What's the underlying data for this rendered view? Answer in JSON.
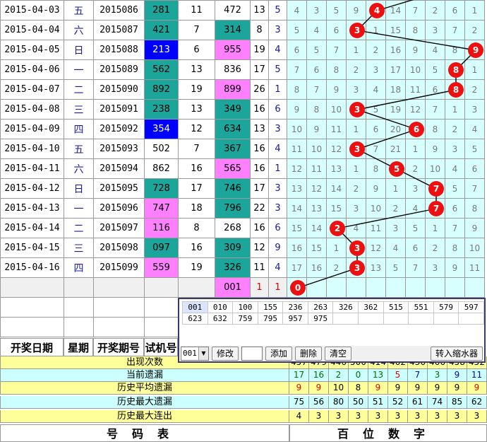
{
  "rows": [
    {
      "date": "2015-04-03",
      "week": "五",
      "issue": "2015086",
      "t": "281",
      "t_hl": "teal",
      "s": "11",
      "n": "472",
      "n_hl": "",
      "a": "13",
      "b": "5",
      "cells": [
        "4",
        "3",
        "5",
        "9",
        "",
        "14",
        "7",
        "2",
        "6",
        "1"
      ],
      "ball": "4",
      "ball_col": 4
    },
    {
      "date": "2015-04-04",
      "week": "六",
      "issue": "2015087",
      "t": "421",
      "t_hl": "teal",
      "s": "7",
      "n": "314",
      "n_hl": "teal",
      "a": "8",
      "b": "3",
      "cells": [
        "5",
        "4",
        "6",
        "",
        "1",
        "15",
        "8",
        "3",
        "7",
        "2"
      ],
      "ball": "3",
      "ball_col": 3
    },
    {
      "date": "2015-04-05",
      "week": "日",
      "issue": "2015088",
      "t": "213",
      "t_hl": "blue",
      "s": "6",
      "n": "955",
      "n_hl": "pink",
      "a": "19",
      "b": "4",
      "cells": [
        "6",
        "5",
        "7",
        "1",
        "2",
        "16",
        "9",
        "4",
        "8",
        ""
      ],
      "ball": "9",
      "ball_col": 9
    },
    {
      "date": "2015-04-06",
      "week": "一",
      "issue": "2015089",
      "t": "562",
      "t_hl": "teal",
      "s": "13",
      "n": "836",
      "n_hl": "",
      "a": "17",
      "b": "5",
      "cells": [
        "7",
        "6",
        "8",
        "2",
        "3",
        "17",
        "10",
        "5",
        "",
        "1"
      ],
      "ball": "8",
      "ball_col": 8
    },
    {
      "date": "2015-04-07",
      "week": "二",
      "issue": "2015090",
      "t": "892",
      "t_hl": "teal",
      "s": "19",
      "n": "899",
      "n_hl": "pink",
      "a": "26",
      "b": "1",
      "cells": [
        "8",
        "7",
        "9",
        "3",
        "4",
        "18",
        "11",
        "6",
        "",
        "2"
      ],
      "ball": "8",
      "ball_col": 8
    },
    {
      "date": "2015-04-08",
      "week": "三",
      "issue": "2015091",
      "t": "238",
      "t_hl": "teal",
      "s": "13",
      "n": "349",
      "n_hl": "teal",
      "a": "16",
      "b": "6",
      "cells": [
        "9",
        "8",
        "10",
        "",
        "5",
        "19",
        "12",
        "7",
        "1",
        "3"
      ],
      "ball": "3",
      "ball_col": 3
    },
    {
      "date": "2015-04-09",
      "week": "四",
      "issue": "2015092",
      "t": "354",
      "t_hl": "blue",
      "s": "12",
      "n": "634",
      "n_hl": "teal",
      "a": "13",
      "b": "3",
      "cells": [
        "10",
        "9",
        "11",
        "1",
        "6",
        "20",
        "",
        "8",
        "2",
        "4"
      ],
      "ball": "6",
      "ball_col": 6
    },
    {
      "date": "2015-04-10",
      "week": "五",
      "issue": "2015093",
      "t": "502",
      "t_hl": "",
      "s": "7",
      "n": "367",
      "n_hl": "teal",
      "a": "16",
      "b": "4",
      "cells": [
        "11",
        "10",
        "12",
        "",
        "7",
        "21",
        "1",
        "9",
        "3",
        "5"
      ],
      "ball": "3",
      "ball_col": 3
    },
    {
      "date": "2015-04-11",
      "week": "六",
      "issue": "2015094",
      "t": "862",
      "t_hl": "",
      "s": "16",
      "n": "565",
      "n_hl": "pink",
      "a": "16",
      "b": "1",
      "cells": [
        "12",
        "11",
        "13",
        "1",
        "8",
        "",
        "2",
        "10",
        "4",
        "6"
      ],
      "ball": "5",
      "ball_col": 5
    },
    {
      "date": "2015-04-12",
      "week": "日",
      "issue": "2015095",
      "t": "728",
      "t_hl": "teal",
      "s": "17",
      "n": "746",
      "n_hl": "teal",
      "a": "17",
      "b": "3",
      "cells": [
        "13",
        "12",
        "14",
        "2",
        "9",
        "1",
        "3",
        "",
        "5",
        "7"
      ],
      "ball": "7",
      "ball_col": 7
    },
    {
      "date": "2015-04-13",
      "week": "一",
      "issue": "2015096",
      "t": "747",
      "t_hl": "pink",
      "s": "18",
      "n": "796",
      "n_hl": "teal",
      "a": "22",
      "b": "3",
      "cells": [
        "14",
        "13",
        "15",
        "3",
        "10",
        "2",
        "4",
        "",
        "6",
        "8"
      ],
      "ball": "7",
      "ball_col": 7
    },
    {
      "date": "2015-04-14",
      "week": "二",
      "issue": "2015097",
      "t": "116",
      "t_hl": "pink",
      "s": "8",
      "n": "268",
      "n_hl": "",
      "a": "16",
      "b": "6",
      "cells": [
        "15",
        "14",
        "",
        "4",
        "11",
        "3",
        "5",
        "1",
        "7",
        "9"
      ],
      "ball": "2",
      "ball_col": 2
    },
    {
      "date": "2015-04-15",
      "week": "三",
      "issue": "2015098",
      "t": "097",
      "t_hl": "teal",
      "s": "16",
      "n": "309",
      "n_hl": "teal",
      "a": "12",
      "b": "9",
      "cells": [
        "16",
        "15",
        "1",
        "",
        "12",
        "4",
        "6",
        "2",
        "8",
        "10"
      ],
      "ball": "3",
      "ball_col": 3
    },
    {
      "date": "2015-04-16",
      "week": "四",
      "issue": "2015099",
      "t": "559",
      "t_hl": "pink",
      "s": "19",
      "n": "326",
      "n_hl": "teal",
      "a": "11",
      "b": "4",
      "cells": [
        "17",
        "16",
        "2",
        "",
        "13",
        "5",
        "7",
        "3",
        "9",
        "11"
      ],
      "ball": "3",
      "ball_col": 3
    }
  ],
  "pending": {
    "n": "001",
    "a": "1",
    "b": "1",
    "ball": "0",
    "ball_col": 0
  },
  "header": {
    "date": "开奖日期",
    "week": "星期",
    "issue": "开奖期号",
    "trial": "试机号"
  },
  "stats": [
    {
      "label": "出现次数",
      "values": [
        "457",
        "479",
        "446",
        "500",
        "414",
        "462",
        "436",
        "466",
        "458",
        "452"
      ],
      "bg": "yellow"
    },
    {
      "label": "当前遗漏",
      "values": [
        "17",
        "16",
        "2",
        "0",
        "13",
        "5",
        "7",
        "3",
        "9",
        "11"
      ],
      "bg": "cyan",
      "colors": [
        "#007000",
        "#007000",
        "#007000",
        "#007000",
        "#007000",
        "#e00000",
        "#0000c0",
        "#007000",
        "#0000c0",
        "#0000c0"
      ]
    },
    {
      "label": "历史平均遗漏",
      "values": [
        "9",
        "9",
        "10",
        "8",
        "9",
        "9",
        "9",
        "9",
        "9",
        "9"
      ],
      "bg": "yellow",
      "colors": [
        "#e00000",
        "#e00000",
        "#000000",
        "#000000",
        "#e00000",
        "#000000",
        "#000000",
        "#000000",
        "#000000",
        "#e00000"
      ]
    },
    {
      "label": "历史最大遗漏",
      "values": [
        "75",
        "56",
        "80",
        "50",
        "51",
        "52",
        "61",
        "74",
        "85",
        "62"
      ],
      "bg": "cyan"
    },
    {
      "label": "历史最大连出",
      "values": [
        "4",
        "3",
        "3",
        "3",
        "3",
        "3",
        "3",
        "3",
        "3",
        "3"
      ],
      "bg": "yellow"
    }
  ],
  "footer": {
    "left": "号码表",
    "right": "百位数字"
  },
  "panel": {
    "numbers": [
      "001",
      "010",
      "100",
      "155",
      "236",
      "263",
      "326",
      "362",
      "515",
      "551",
      "579",
      "597",
      "623",
      "632",
      "759",
      "795",
      "957",
      "975"
    ],
    "select_value": "001",
    "modify_label": "修改",
    "add_label": "添加",
    "delete_label": "删除",
    "clear_label": "清空",
    "to_filter_label": "转入缩水器"
  },
  "colors": {
    "teal": "#1ba59b",
    "blue": "#0000ff",
    "pink": "#ff80ff",
    "ball": "#ee1010",
    "cool": "#d6fffe"
  }
}
